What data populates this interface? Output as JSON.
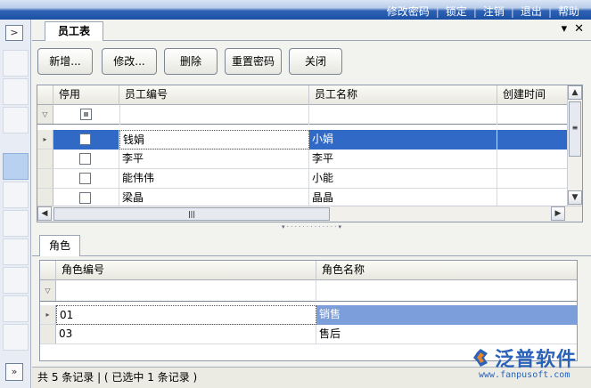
{
  "top_menu": [
    "修改密码",
    "锁定",
    "注销",
    "退出",
    "帮助"
  ],
  "tab": {
    "title": "员工表"
  },
  "toolbar": {
    "add": "新增...",
    "edit": "修改...",
    "delete": "删除",
    "reset_password": "重置密码",
    "close": "关闭"
  },
  "employee_grid": {
    "columns": [
      "停用",
      "员工编号",
      "员工名称",
      "创建时间"
    ],
    "rows": [
      {
        "code": "钱娟",
        "name": "小娟"
      },
      {
        "code": "李平",
        "name": "李平"
      },
      {
        "code": "能伟伟",
        "name": "小能"
      },
      {
        "code": "梁晶",
        "name": "晶晶"
      }
    ]
  },
  "role_tab": {
    "title": "角色"
  },
  "role_grid": {
    "columns": [
      "角色编号",
      "角色名称"
    ],
    "rows": [
      {
        "code": "01",
        "name": "销售"
      },
      {
        "code": "03",
        "name": "售后"
      }
    ]
  },
  "status": {
    "text": "共 5 条记录 | ( 已选中 1 条记录 )"
  },
  "logo": {
    "name": "泛普软件",
    "url": "www.fanpusoft.com"
  }
}
